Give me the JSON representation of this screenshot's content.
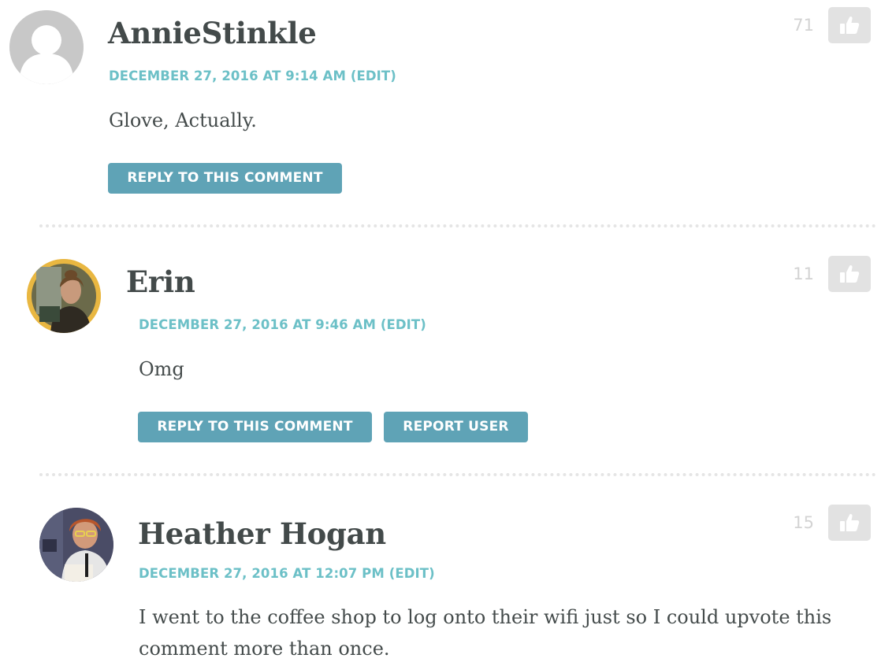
{
  "comments": [
    {
      "author": "AnnieStinkle",
      "date": "DECEMBER 27, 2016 AT 9:14 AM",
      "edit_label": "(EDIT)",
      "body": "Glove, Actually.",
      "votes": "71",
      "reply_label": "REPLY TO THIS COMMENT",
      "avatar": "default-user-icon"
    },
    {
      "author": "Erin",
      "date": "DECEMBER 27, 2016 AT 9:46 AM",
      "edit_label": "(EDIT)",
      "body": "Omg",
      "votes": "11",
      "reply_label": "REPLY TO THIS COMMENT",
      "report_label": "REPORT USER",
      "avatar": "user-photo",
      "avatar_ring_color": "#e9b741"
    },
    {
      "author": "Heather Hogan",
      "date": "DECEMBER 27, 2016 AT 12:07 PM",
      "edit_label": "(EDIT)",
      "body": "I went to the coffee shop to log onto their wifi just so I could upvote this comment more than once.",
      "votes": "15",
      "avatar": "user-photo"
    }
  ],
  "colors": {
    "accent": "#6cc0c7",
    "button": "#5fa3b6",
    "like_button": "#e2e2e2",
    "vote_count": "#d3d3d3"
  },
  "icons": {
    "like": "thumbs-up-icon"
  }
}
